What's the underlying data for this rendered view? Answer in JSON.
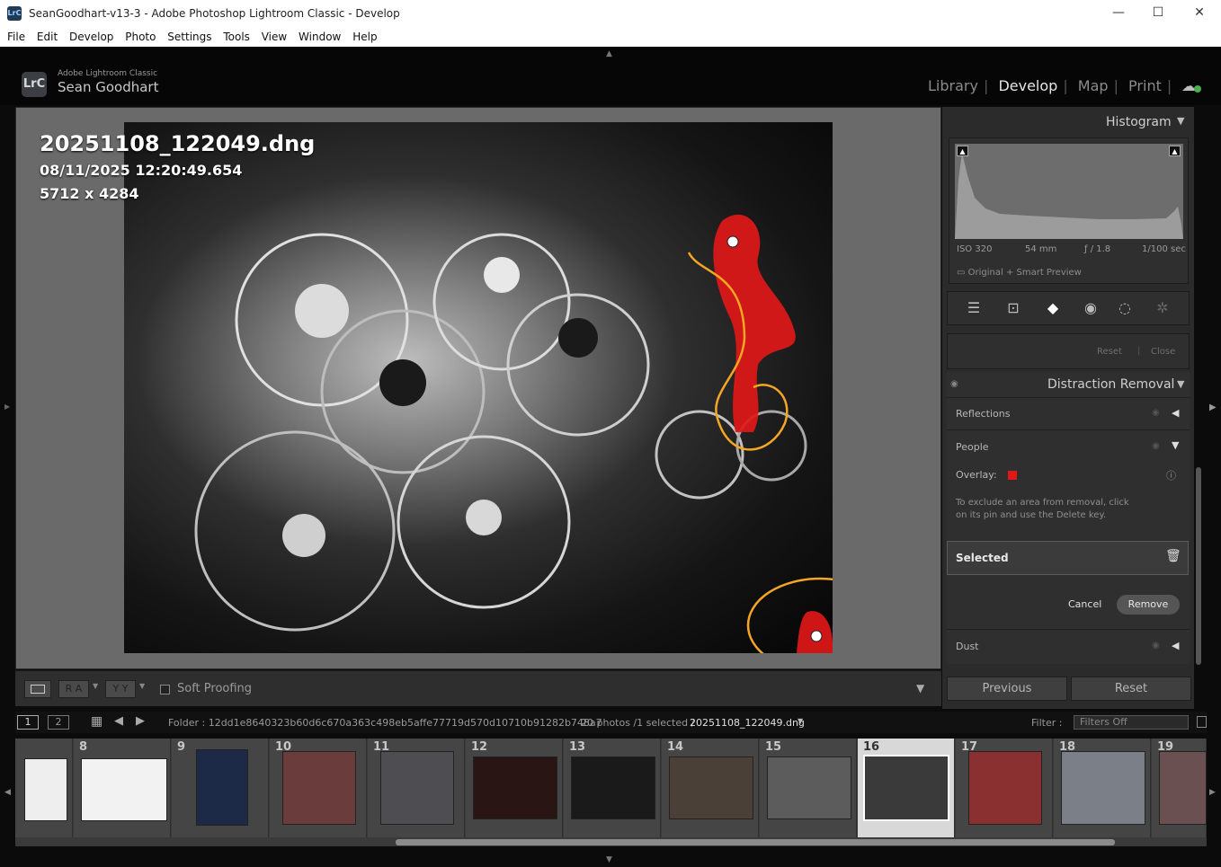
{
  "window": {
    "title": "SeanGoodhart-v13-3 - Adobe Photoshop Lightroom Classic - Develop",
    "app_icon": "LrC"
  },
  "menu": [
    "File",
    "Edit",
    "Develop",
    "Photo",
    "Settings",
    "Tools",
    "View",
    "Window",
    "Help"
  ],
  "identity": {
    "logo": "LrC",
    "app_name": "Adobe Lightroom Classic",
    "user_name": "Sean Goodhart"
  },
  "modules": {
    "library": "Library",
    "develop": "Develop",
    "map": "Map",
    "print": "Print",
    "active": "Develop"
  },
  "photo_info": {
    "filename": "20251108_122049.dng",
    "datetime": "08/11/2025 12:20:49.654",
    "dimensions": "5712 x 4284"
  },
  "toolbar": {
    "soft_proofing": "Soft Proofing",
    "view_ra": "R A",
    "view_yy": "Y Y"
  },
  "histogram": {
    "title": "Histogram",
    "iso": "ISO 320",
    "focal": "54 mm",
    "aperture": "ƒ / 1.8",
    "shutter": "1/100 sec",
    "preview": "Original + Smart Preview"
  },
  "tool_panel": {
    "reset": "Reset",
    "close": "Close"
  },
  "distraction": {
    "title": "Distraction Removal",
    "reflections": "Reflections",
    "people": "People",
    "overlay_label": "Overlay:",
    "overlay_color": "#e01818",
    "hint": "To exclude an area from removal, click on its pin and use the Delete key.",
    "selected": "Selected",
    "cancel": "Cancel",
    "remove": "Remove",
    "dust": "Dust"
  },
  "bottom_buttons": {
    "previous": "Previous",
    "reset": "Reset"
  },
  "filmbar": {
    "page1": "1",
    "page2": "2",
    "folder": "Folder : 12dd1e8640323b60d6c670a363c498eb5affe77719d570d10710b91282b748a7",
    "count": "20 photos /1 selected /",
    "current": "20251108_122049.dng",
    "filter_label": "Filter :",
    "filter_value": "Filters Off"
  },
  "filmstrip": [
    {
      "num": ""
    },
    {
      "num": "8"
    },
    {
      "num": "9"
    },
    {
      "num": "10"
    },
    {
      "num": "11"
    },
    {
      "num": "12"
    },
    {
      "num": "13"
    },
    {
      "num": "14"
    },
    {
      "num": "15"
    },
    {
      "num": "16"
    },
    {
      "num": "17"
    },
    {
      "num": "18"
    },
    {
      "num": "19"
    }
  ]
}
